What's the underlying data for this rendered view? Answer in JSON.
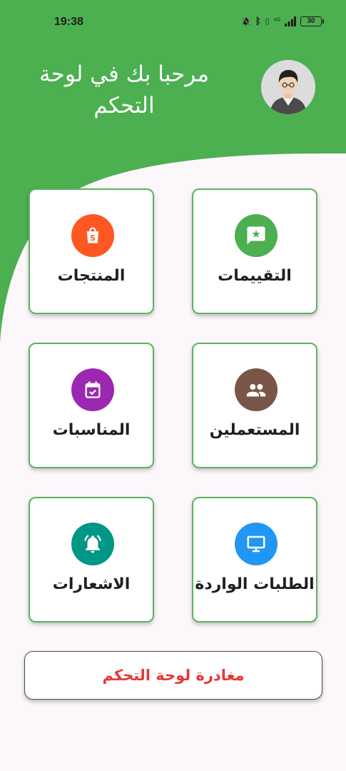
{
  "status_bar": {
    "time": "19:38",
    "battery": "30",
    "network": "⁴ᴳ"
  },
  "header": {
    "title": "مرحبا بك في لوحة التحكم"
  },
  "colors": {
    "primary_green": "#4caf50",
    "card_border": "#5bb45e",
    "exit_text": "#e53935"
  },
  "cards": [
    {
      "label": "التقييمات",
      "icon": "rate-review-icon",
      "color": "#4caf50"
    },
    {
      "label": "المنتجات",
      "icon": "shopify-bag-icon",
      "color": "#ff5722"
    },
    {
      "label": "المستعملين",
      "icon": "people-icon",
      "color": "#795548"
    },
    {
      "label": "المناسبات",
      "icon": "event-available-icon",
      "color": "#9c27b0"
    },
    {
      "label": "الطلبات الواردة",
      "icon": "desktop-monitor-icon",
      "color": "#2196f3"
    },
    {
      "label": "الاشعارات",
      "icon": "notification-bell-icon",
      "color": "#009688"
    }
  ],
  "exit_button": {
    "label": "مغادرة لوحة التحكم"
  }
}
